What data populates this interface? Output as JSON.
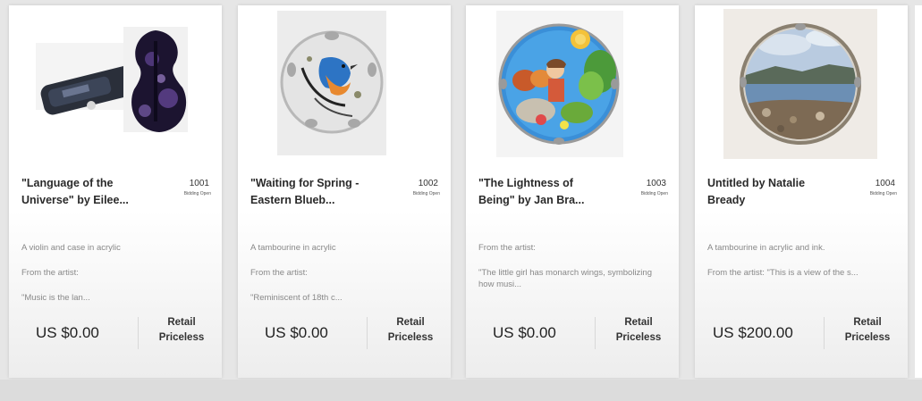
{
  "lots": [
    {
      "title": "\"Language of the Universe\" by Eilee...",
      "lot_number": "1001",
      "status": "Bidding Open",
      "description": [
        "A violin and case in acrylic",
        "From the artist:",
        "\"Music is the lan..."
      ],
      "price": "US $0.00",
      "retail_label": "Retail",
      "retail_value": "Priceless",
      "image_icon": "violin-artwork-image"
    },
    {
      "title": "\"Waiting for Spring - Eastern Blueb...",
      "lot_number": "1002",
      "status": "Bidding Open",
      "description": [
        "A tambourine in acrylic",
        "From the artist:",
        "\"Reminiscent of 18th c..."
      ],
      "price": "US $0.00",
      "retail_label": "Retail",
      "retail_value": "Priceless",
      "image_icon": "bluebird-tambourine-image"
    },
    {
      "title": "\"The Lightness of Being\" by Jan Bra...",
      "lot_number": "1003",
      "status": "Bidding Open",
      "description": [
        "From the artist:",
        "\"The little girl has monarch wings, symbolizing how musi..."
      ],
      "price": "US $0.00",
      "retail_label": "Retail",
      "retail_value": "Priceless",
      "image_icon": "girl-tambourine-image"
    },
    {
      "title": "Untitled by Natalie Bready",
      "lot_number": "1004",
      "status": "Bidding Open",
      "description": [
        "A tambourine in acrylic and ink.",
        "From the artist: \"This is a view of the s..."
      ],
      "price": "US $200.00",
      "retail_label": "Retail",
      "retail_value": "Priceless",
      "image_icon": "seascape-tambourine-image"
    }
  ]
}
